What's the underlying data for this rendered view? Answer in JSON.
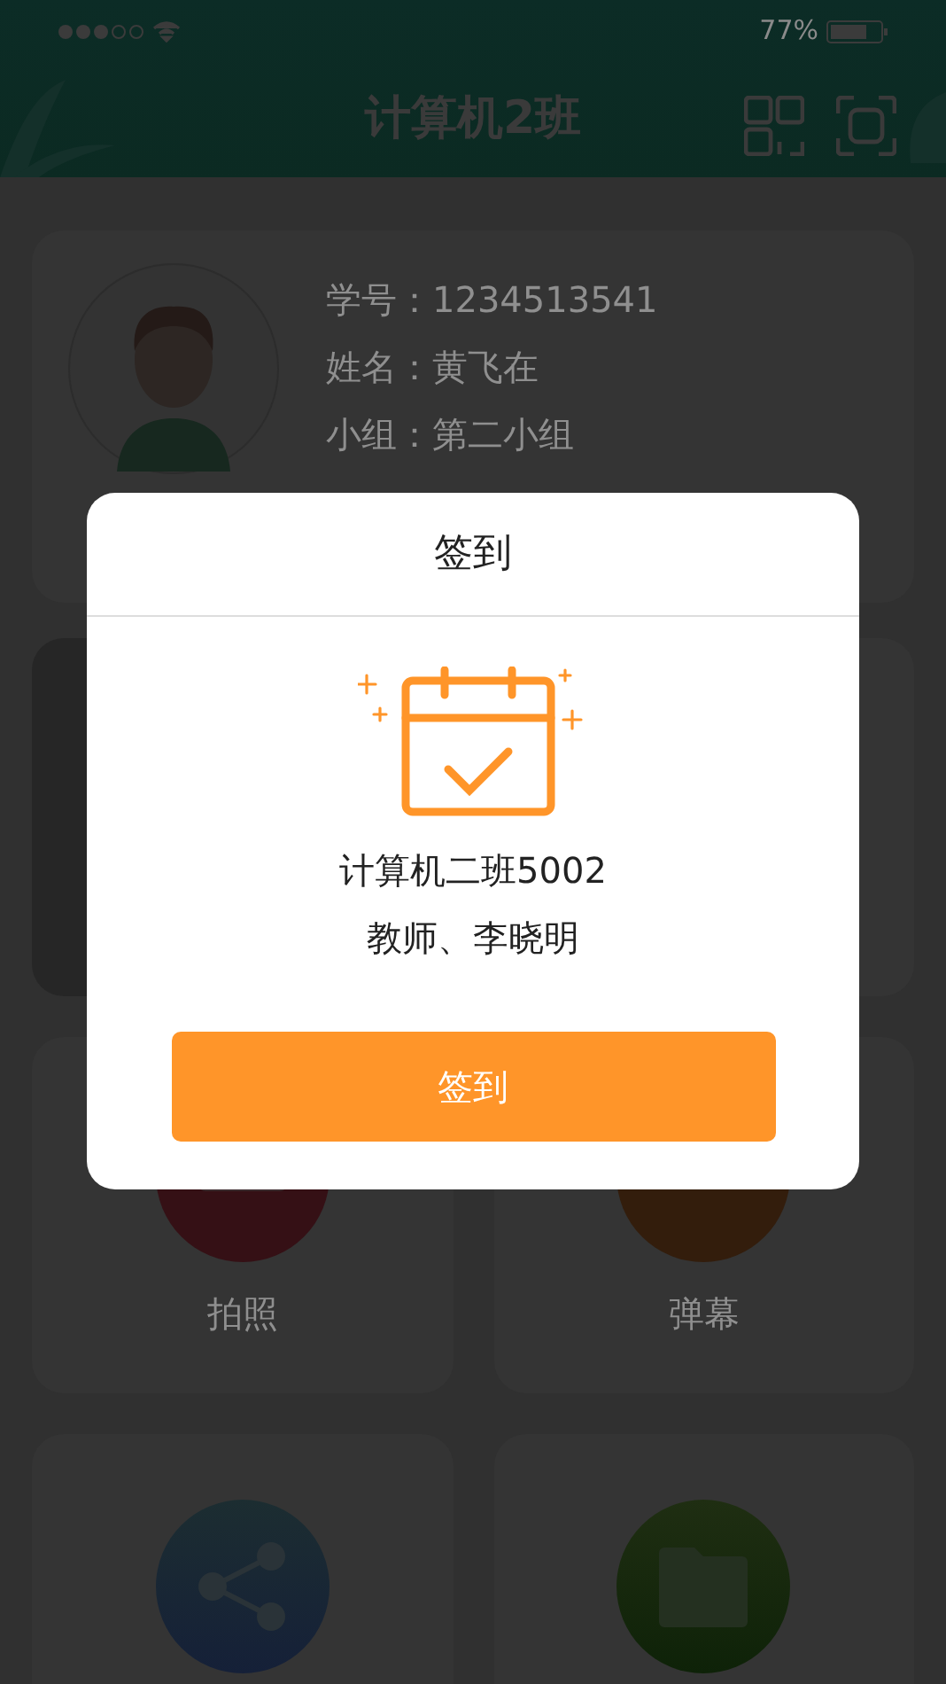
{
  "status_bar": {
    "battery": "77%"
  },
  "header": {
    "title": "计算机2班"
  },
  "profile": {
    "fields": [
      {
        "label": "学号：",
        "value": "1234513541"
      },
      {
        "label": "姓名：",
        "value": "黄飞在"
      },
      {
        "label": "小组：",
        "value": "第二小组"
      }
    ]
  },
  "tiles": [
    {
      "label": "拍照"
    },
    {
      "label": "弹幕"
    }
  ],
  "dialog": {
    "title": "签到",
    "lines": [
      "计算机二班5002",
      "教师、李晓明"
    ],
    "button": "签到"
  }
}
